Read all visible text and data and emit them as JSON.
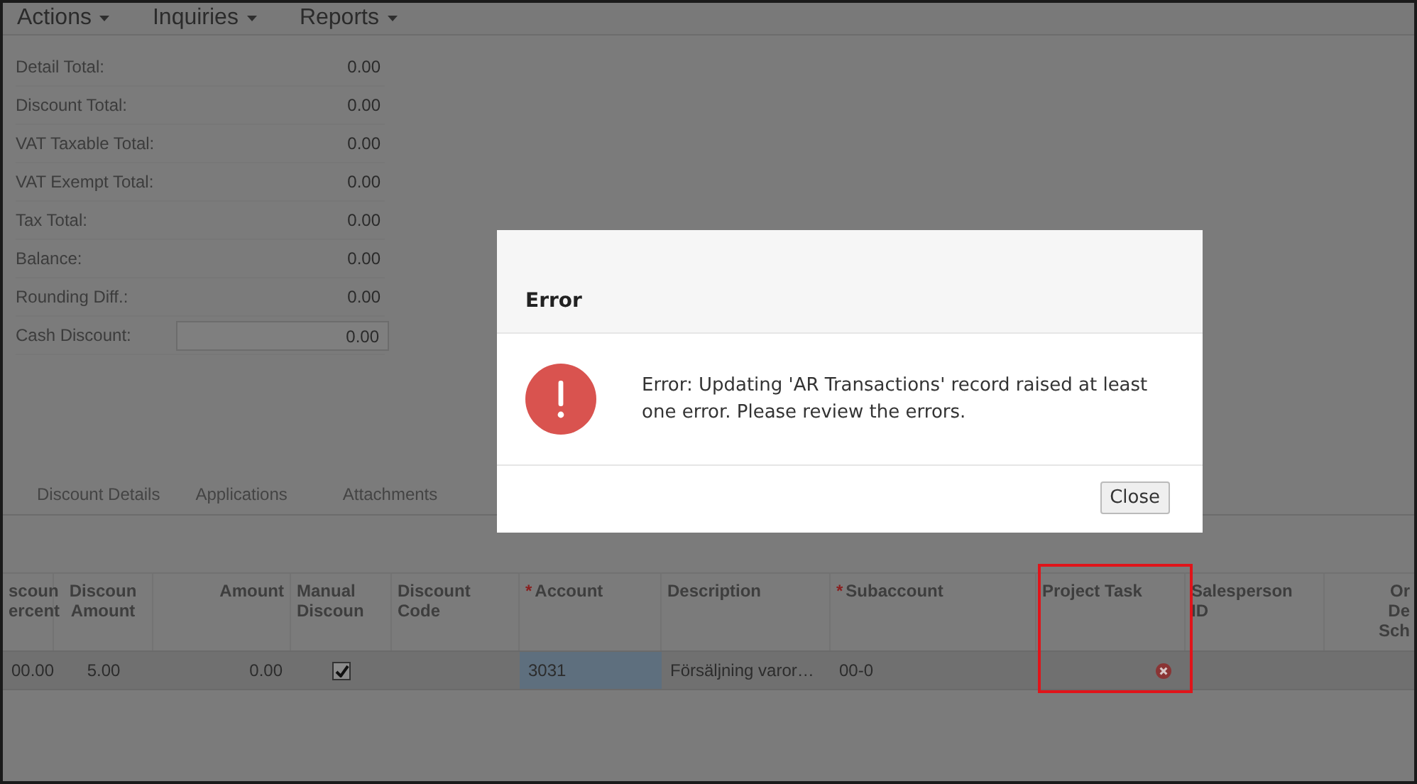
{
  "menu": [
    {
      "label": "Actions"
    },
    {
      "label": "Inquiries"
    },
    {
      "label": "Reports"
    }
  ],
  "totals": [
    {
      "label": "Detail Total:",
      "value": "0.00",
      "kind": "text"
    },
    {
      "label": "Discount Total:",
      "value": "0.00",
      "kind": "text"
    },
    {
      "label": "VAT Taxable Total:",
      "value": "0.00",
      "kind": "text"
    },
    {
      "label": "VAT Exempt Total:",
      "value": "0.00",
      "kind": "text"
    },
    {
      "label": "Tax Total:",
      "value": "0.00",
      "kind": "text"
    },
    {
      "label": "Balance:",
      "value": "0.00",
      "kind": "text"
    },
    {
      "label": "Rounding Diff.:",
      "value": "0.00",
      "kind": "text"
    },
    {
      "label": "Cash Discount:",
      "value": "0.00",
      "kind": "field"
    }
  ],
  "tabs": [
    {
      "label": "Discount Details"
    },
    {
      "label": "Applications"
    },
    {
      "label": "Attachments"
    }
  ],
  "table": {
    "columns": [
      {
        "label": "scoun\nercent"
      },
      {
        "label": "Discoun\nAmount"
      },
      {
        "label": "Amount"
      },
      {
        "label": "Manual\nDiscoun"
      },
      {
        "label": "Discount\nCode"
      },
      {
        "label": "Account",
        "required_mark": "*"
      },
      {
        "label": "Description"
      },
      {
        "label": "Subaccount",
        "required_mark": "*"
      },
      {
        "label": "Project Task"
      },
      {
        "label": "Salesperson\nID"
      },
      {
        "label": "Or\nDe\nSch"
      }
    ],
    "rows": [
      {
        "cells": [
          {
            "kind": "text",
            "text": "00.00",
            "active": false
          },
          {
            "kind": "text",
            "text": "5.00",
            "active": false
          },
          {
            "kind": "text",
            "text": "0.00",
            "active": false
          },
          {
            "kind": "checkbox",
            "checked": true,
            "active": false
          },
          {
            "kind": "empty",
            "active": false
          },
          {
            "kind": "text",
            "text": "3031",
            "active": true
          },
          {
            "kind": "text",
            "text": "Försäljning varor…",
            "active": false
          },
          {
            "kind": "text",
            "text": "00-0",
            "active": false
          },
          {
            "kind": "error",
            "active": false
          },
          {
            "kind": "empty",
            "active": false
          },
          {
            "kind": "empty",
            "active": false
          }
        ]
      }
    ]
  },
  "dialog": {
    "title": "Error",
    "message": "Error: Updating 'AR Transactions' record raised at least one error. Please review the errors.",
    "button": "Close"
  }
}
